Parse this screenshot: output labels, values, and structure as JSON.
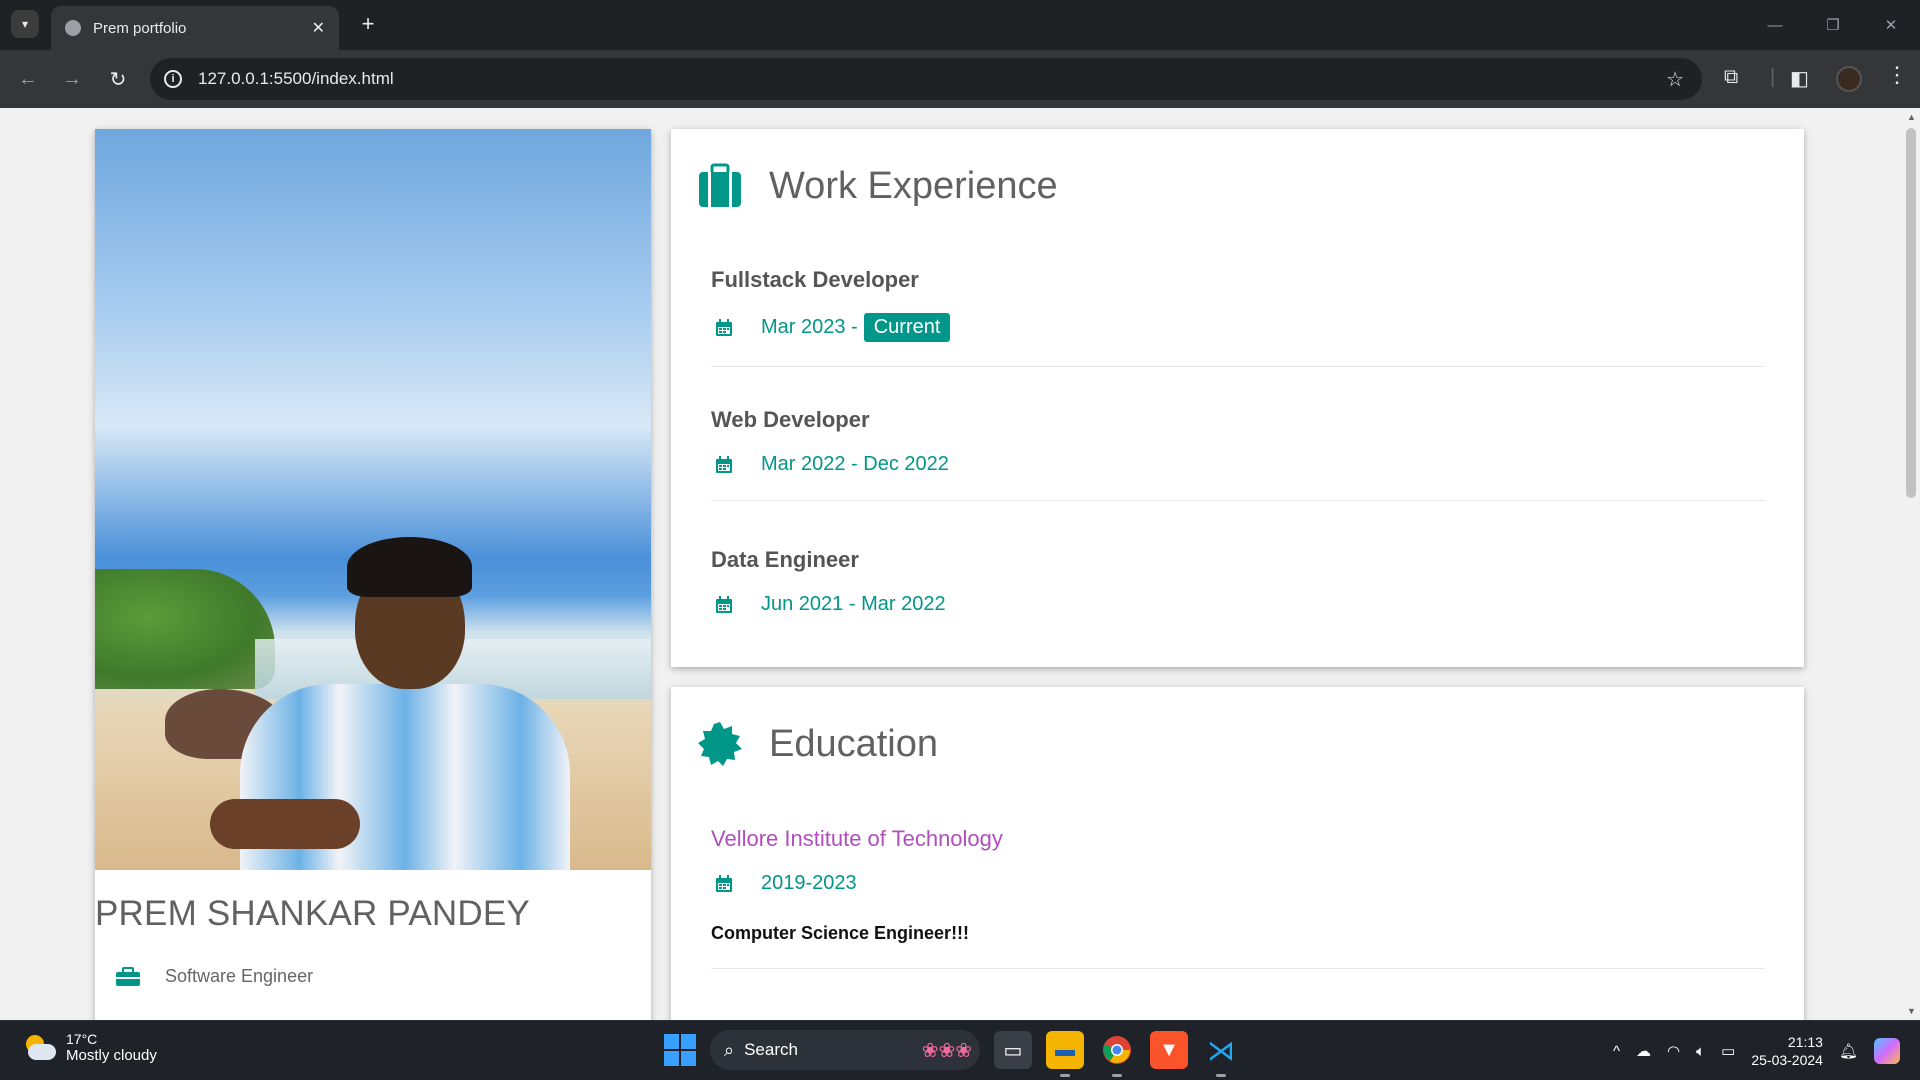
{
  "browser": {
    "tab_title": "Prem portfolio",
    "tab_close": "✕",
    "new_tab": "+",
    "url": "127.0.0.1:5500/index.html"
  },
  "profile": {
    "name": "PREM SHANKAR PANDEY",
    "title": "Software Engineer"
  },
  "work": {
    "heading": "Work Experience",
    "items": [
      {
        "role": "Fullstack Developer",
        "dates": "Mar 2023 - ",
        "tag": "Current"
      },
      {
        "role": "Web Developer",
        "dates": "Mar 2022 - Dec 2022"
      },
      {
        "role": "Data Engineer",
        "dates": "Jun 2021 - Mar 2022"
      }
    ]
  },
  "education": {
    "heading": "Education",
    "items": [
      {
        "school": "Vellore Institute of Technology",
        "years": "2019-2023",
        "degree": "Computer Science Engineer!!!"
      }
    ]
  },
  "taskbar": {
    "temperature": "17°C",
    "weather": "Mostly cloudy",
    "search_label": "Search",
    "time": "21:13",
    "date": "25-03-2024"
  },
  "colors": {
    "accent": "#009688",
    "school": "#b04fbc",
    "heading": "#616161"
  },
  "icons": [
    "info-icon",
    "star-icon",
    "extensions-icon",
    "sidebar-icon",
    "briefcase-icon",
    "calendar-icon",
    "certificate-icon",
    "search-icon",
    "windows-start-icon"
  ]
}
